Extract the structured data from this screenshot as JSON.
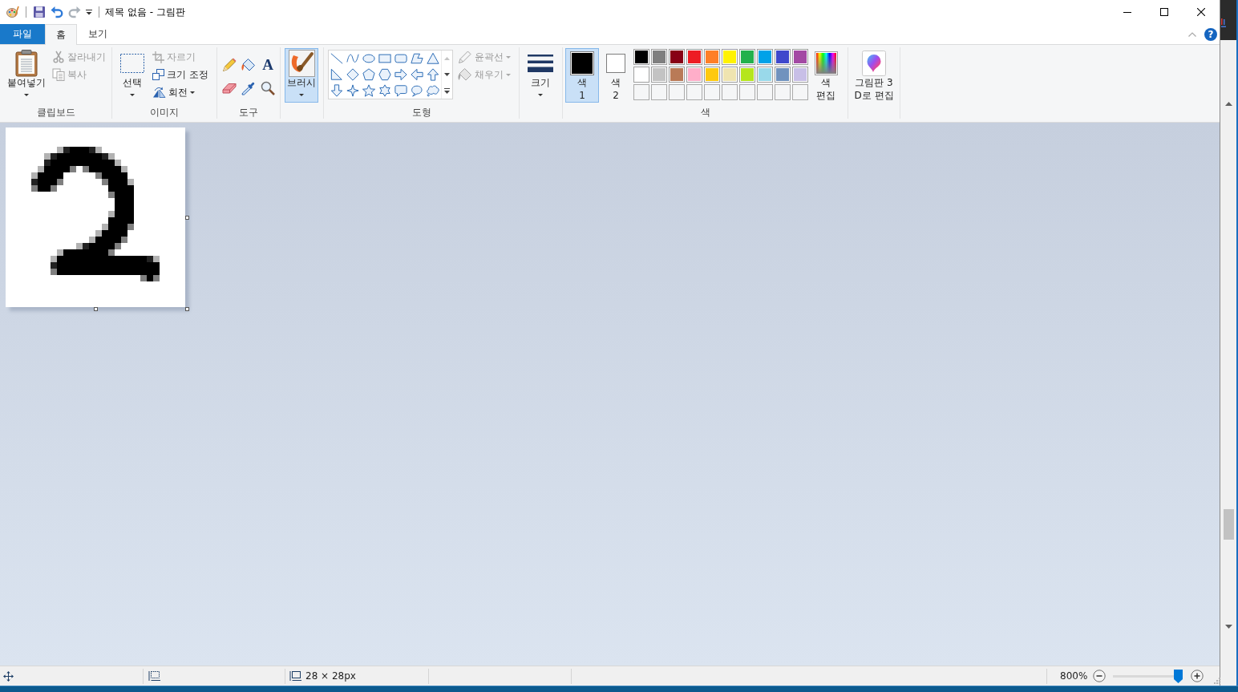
{
  "title_bar": {
    "title": "제목 없음 - 그림판"
  },
  "tabs": [
    {
      "label": "파일",
      "kind": "file",
      "selected": false
    },
    {
      "label": "홈",
      "kind": "tab",
      "selected": true
    },
    {
      "label": "보기",
      "kind": "tab",
      "selected": false
    }
  ],
  "help": {
    "glyph": "?"
  },
  "ribbon": {
    "clipboard": {
      "label": "클립보드",
      "paste": {
        "label": "붙여넣기"
      },
      "items": [
        {
          "kind": "cut",
          "label": "잘라내기",
          "disabled": true
        },
        {
          "kind": "copy",
          "label": "복사",
          "disabled": true
        }
      ]
    },
    "image": {
      "label": "이미지",
      "select": {
        "label": "선택"
      },
      "items": [
        {
          "kind": "crop",
          "label": "자르기",
          "disabled": true
        },
        {
          "kind": "resize",
          "label": "크기 조정",
          "disabled": false
        },
        {
          "kind": "rotate",
          "label": "회전",
          "disabled": false
        }
      ]
    },
    "tools": {
      "label": "도구",
      "text_glyph": "A"
    },
    "brush": {
      "label": "브러시",
      "selected": true
    },
    "shapes": {
      "label": "도형",
      "options": [
        {
          "kind": "outline",
          "label": "윤곽선",
          "disabled": true
        },
        {
          "kind": "fill",
          "label": "채우기",
          "disabled": true
        }
      ]
    },
    "size": {
      "label": "크기"
    },
    "colors": {
      "label": "색",
      "slots": [
        {
          "label": "색\n1",
          "color": "#000000",
          "selected": true
        },
        {
          "label": "색\n2",
          "color": "#ffffff",
          "selected": false
        }
      ],
      "palette": [
        {
          "kind": "swatch",
          "color": "#000000"
        },
        {
          "kind": "swatch",
          "color": "#7f7f7f"
        },
        {
          "kind": "swatch",
          "color": "#880015"
        },
        {
          "kind": "swatch",
          "color": "#ed1c24"
        },
        {
          "kind": "swatch",
          "color": "#ff7f27"
        },
        {
          "kind": "swatch",
          "color": "#fff200"
        },
        {
          "kind": "swatch",
          "color": "#22b14c"
        },
        {
          "kind": "swatch",
          "color": "#00a2e8"
        },
        {
          "kind": "swatch",
          "color": "#3f48cc"
        },
        {
          "kind": "swatch",
          "color": "#a349a4"
        },
        {
          "kind": "swatch",
          "color": "#ffffff"
        },
        {
          "kind": "swatch",
          "color": "#c3c3c3"
        },
        {
          "kind": "swatch",
          "color": "#b97a57"
        },
        {
          "kind": "swatch",
          "color": "#ffaec9"
        },
        {
          "kind": "swatch",
          "color": "#ffc90e"
        },
        {
          "kind": "swatch",
          "color": "#efe4b0"
        },
        {
          "kind": "swatch",
          "color": "#b5e61d"
        },
        {
          "kind": "swatch",
          "color": "#99d9ea"
        },
        {
          "kind": "swatch",
          "color": "#7092be"
        },
        {
          "kind": "swatch",
          "color": "#c8bfe7"
        },
        {
          "kind": "empty"
        },
        {
          "kind": "empty"
        },
        {
          "kind": "empty"
        },
        {
          "kind": "empty"
        },
        {
          "kind": "empty"
        },
        {
          "kind": "empty"
        },
        {
          "kind": "empty"
        },
        {
          "kind": "empty"
        },
        {
          "kind": "empty"
        },
        {
          "kind": "empty"
        }
      ],
      "edit": {
        "label": "색\n편집"
      }
    },
    "paint3d": {
      "label": "그림판 3\nD로 편집"
    }
  },
  "status_bar": {
    "canvas_size": "28 × 28px",
    "zoom": {
      "reading": "800%",
      "level": 0.95
    }
  }
}
